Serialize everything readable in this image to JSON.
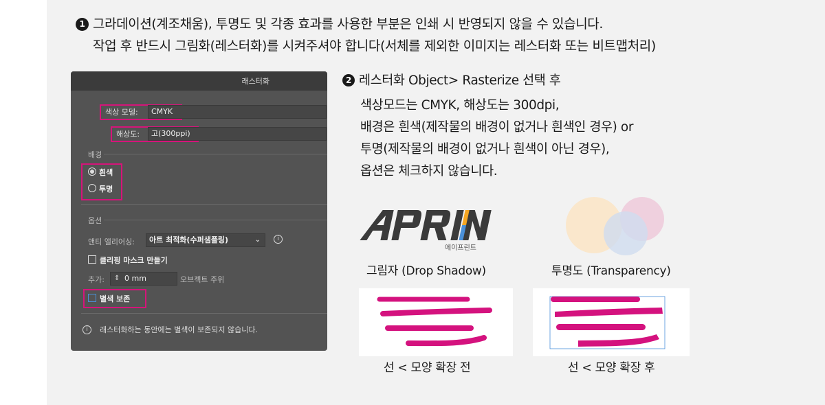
{
  "notes": {
    "line1_marker": "1",
    "line1": "그라데이션(계조채움), 투명도 및 각종 효과를 사용한 부분은 인쇄 시 반영되지 않을 수 있습니다.",
    "line2": "작업 후 반드시 그림화(레스터화)를 시켜주셔야 합니다(서체를 제외한 이미지는 레스터화 또는 비트맵처리)"
  },
  "dialog": {
    "title": "래스터화",
    "color_model_label": "색상 모델:",
    "color_model_value": "CMYK",
    "resolution_label": "해상도:",
    "resolution_value": "고(300ppi)",
    "background_section": "배경",
    "bg_white": "흰색",
    "bg_transparent": "투명",
    "options_section": "옵션",
    "antialias_label": "앤티 앨리어싱:",
    "antialias_value": "아트 최적화(수퍼샘플링)",
    "clipping_mask": "클리핑 마스크 만들기",
    "add_label": "추가:",
    "add_value": "0 mm",
    "add_suffix": "오브젝트 주위",
    "preserve_spot": "별색 보존",
    "footer_note": "래스터화하는 동안에는 별색이 보존되지 않습니다."
  },
  "instructions": {
    "marker": "2",
    "line1": "레스터화 Object> Rasterize 선택 후",
    "line2": "색상모드는 CMYK, 해상도는 300dpi,",
    "line3": "배경은 흰색(제작물의 배경이 없거나 흰색인 경우) or",
    "line4": "투명(제작물의 배경이 없거나 흰색이 아닌 경우),",
    "line5": "옵션은 체크하지 않습니다."
  },
  "examples": {
    "logo_text": "APRINT",
    "logo_sub": "에이프린트",
    "drop_shadow_caption": "그림자 (Drop Shadow)",
    "transparency_caption": "투명도 (Transparency)",
    "before_caption": "선 < 모양 확장 전",
    "after_caption": "선 < 모양 확장 후"
  },
  "colors": {
    "highlight": "#d6147a",
    "stroke": "#d4127e",
    "circle_orange": "#fbe6c8",
    "circle_pink": "#efcadb",
    "circle_blue": "#cfdcef"
  }
}
